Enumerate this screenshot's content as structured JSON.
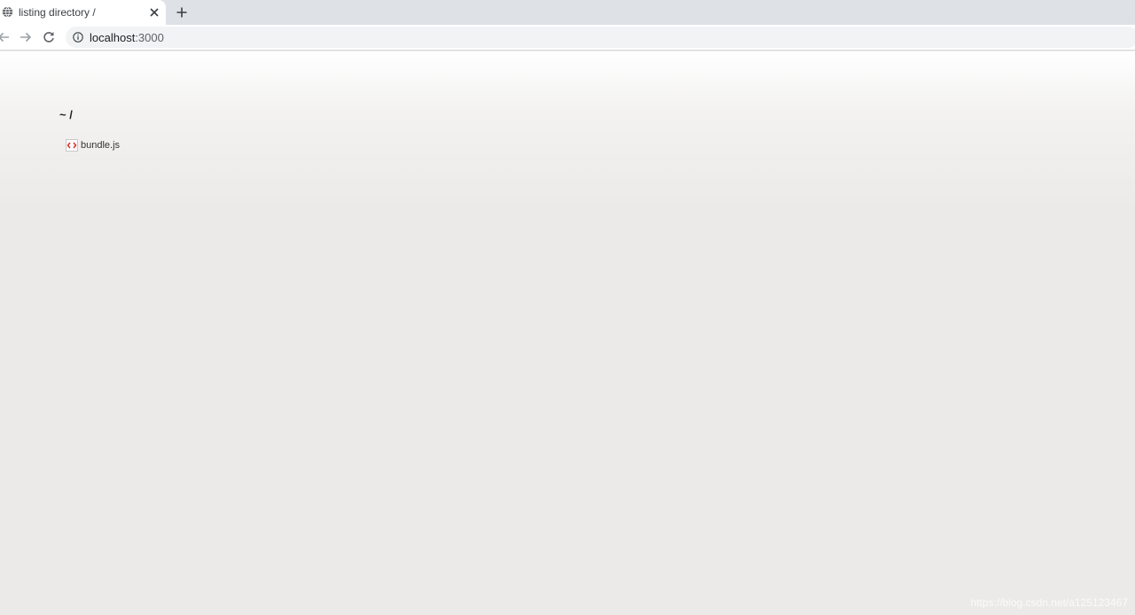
{
  "browser": {
    "tab": {
      "title": "listing directory /"
    },
    "address_bar": {
      "host": "localhost",
      "port": ":3000"
    }
  },
  "page": {
    "heading": "~ /",
    "files": [
      {
        "name": "bundle.js",
        "icon": "js-file-icon"
      }
    ]
  },
  "watermark": "https://blog.csdn.net/a125123467",
  "colors": {
    "tab_strip": "#dee1e6",
    "omnibox": "#f1f3f4",
    "page_background": "#ebeae8",
    "file_icon_accent": "#d93025"
  }
}
